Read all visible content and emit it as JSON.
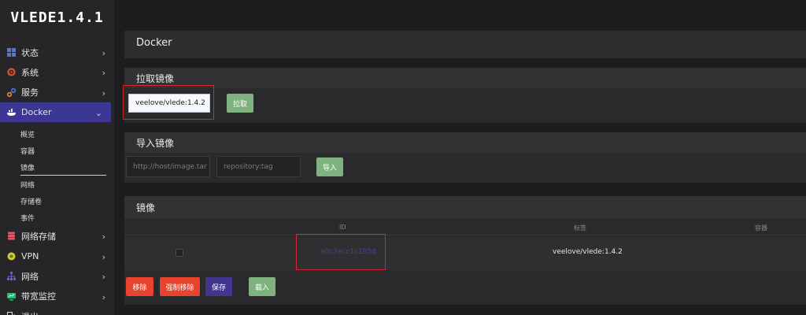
{
  "app": {
    "logo": "VLEDE1.4.1"
  },
  "sidebar": {
    "items": [
      {
        "label": "状态",
        "icon": "grid-icon",
        "color": "#4a78e0"
      },
      {
        "label": "系统",
        "icon": "gear-icon",
        "color": "#e14b2f"
      },
      {
        "label": "服务",
        "icon": "link-icon",
        "color": "#e58a2e"
      },
      {
        "label": "Docker",
        "icon": "docker-icon",
        "color": "#ffffff",
        "chevron": "down"
      }
    ],
    "docker_sub": [
      "概览",
      "容器",
      "镜像",
      "网络",
      "存储卷",
      "事件"
    ],
    "items_after": [
      {
        "label": "网络存储",
        "icon": "storage-icon",
        "color": "#e05a6a"
      },
      {
        "label": "VPN",
        "icon": "vpn-icon",
        "color": "#d9c52e"
      },
      {
        "label": "网络",
        "icon": "network-icon",
        "color": "#7a5ad0"
      },
      {
        "label": "带宽监控",
        "icon": "monitor-icon",
        "color": "#2bb673"
      },
      {
        "label": "退出",
        "icon": "logout-icon",
        "color": "#dddddd"
      }
    ]
  },
  "page": {
    "title": "Docker"
  },
  "pull": {
    "title": "拉取镜像",
    "input_value": "veelove/vlede:1.4.2",
    "button": "拉取"
  },
  "import": {
    "title": "导入镜像",
    "url_placeholder": "http://host/image.tar",
    "tag_placeholder": "repository:tag",
    "button": "导入"
  },
  "images": {
    "title": "镜像",
    "columns": {
      "id": "ID",
      "tag": "标签",
      "container": "容器"
    },
    "rows": [
      {
        "id": "a0c7ecc1c195d",
        "tag": "veelove/vlede:1.4.2"
      }
    ],
    "actions": {
      "remove": "移除",
      "force_remove": "强制移除",
      "save": "保存",
      "load": "载入"
    }
  }
}
